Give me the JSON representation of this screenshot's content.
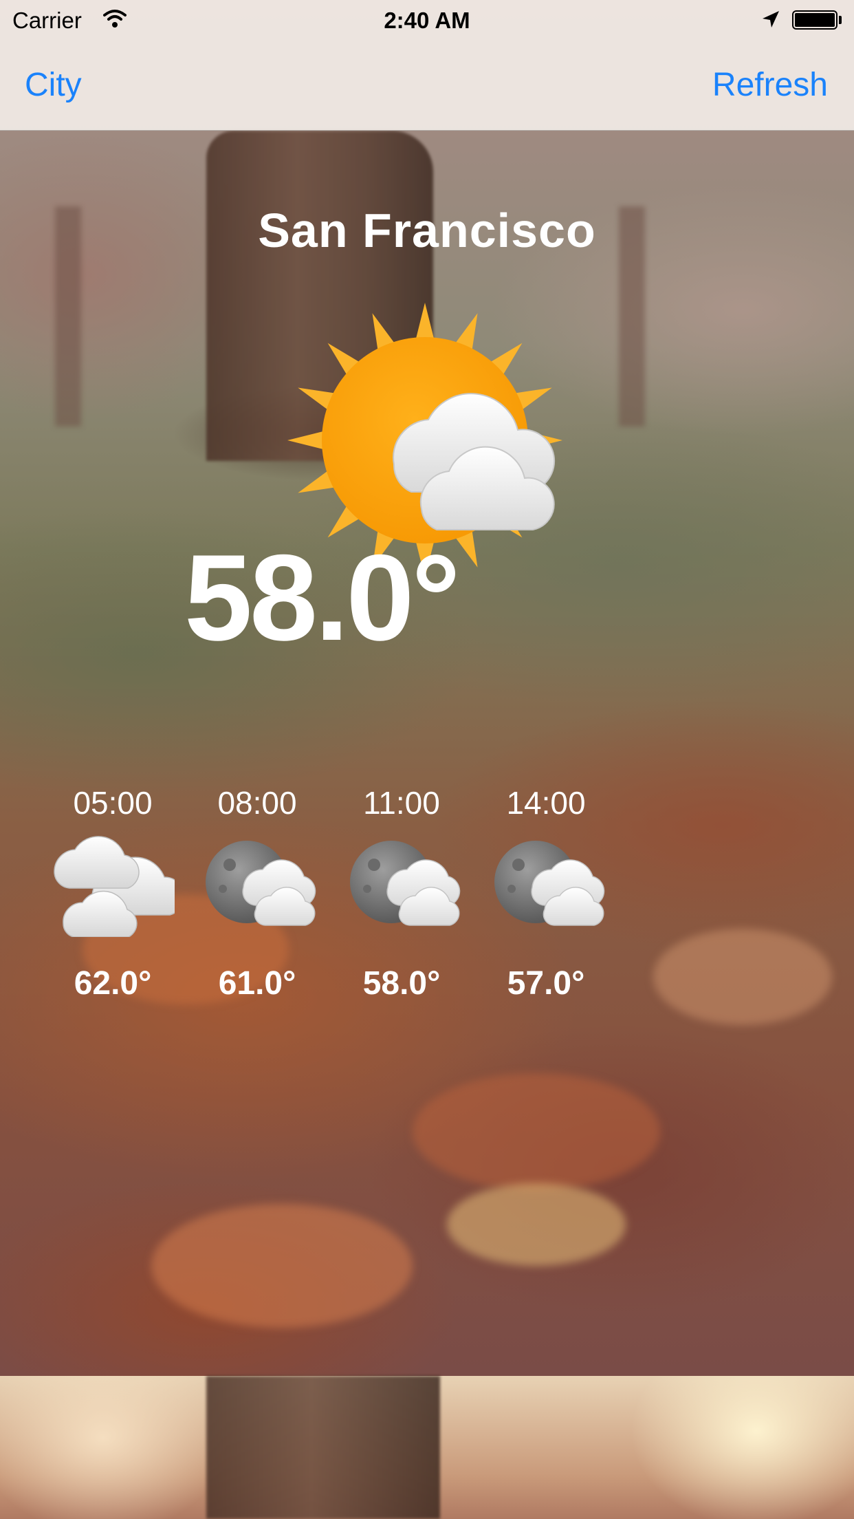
{
  "status_bar": {
    "carrier": "Carrier",
    "time": "2:40 AM",
    "wifi_icon": "wifi-icon",
    "location_icon": "location-arrow-icon",
    "battery_icon": "battery-full-icon"
  },
  "nav": {
    "left_button": "City",
    "right_button": "Refresh",
    "accent_color": "#1a82fb"
  },
  "current": {
    "city": "San Francisco",
    "temperature": "58.0°",
    "icon": "sun-with-clouds-icon"
  },
  "forecast": [
    {
      "time": "05:00",
      "temperature": "62.0°",
      "icon": "cloudy-icon"
    },
    {
      "time": "08:00",
      "temperature": "61.0°",
      "icon": "moon-with-clouds-icon"
    },
    {
      "time": "11:00",
      "temperature": "58.0°",
      "icon": "moon-with-clouds-icon"
    },
    {
      "time": "14:00",
      "temperature": "57.0°",
      "icon": "moon-with-clouds-icon"
    }
  ]
}
